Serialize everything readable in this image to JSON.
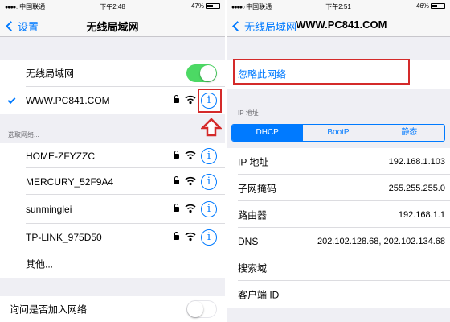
{
  "left": {
    "status": {
      "carrier": "中国联通",
      "time": "下午2:48",
      "battery": "47%",
      "battery_level": 0.47
    },
    "nav": {
      "back": "设置",
      "title": "无线局域网"
    },
    "wlan": {
      "label": "无线局域网",
      "on": true
    },
    "connected": {
      "name": "WWW.PC841.COM"
    },
    "choose_label": "选取网络...",
    "networks": [
      {
        "name": "HOME-ZFYZZC"
      },
      {
        "name": "MERCURY_52F9A4"
      },
      {
        "name": "sunminglei"
      },
      {
        "name": "TP-LINK_975D50"
      }
    ],
    "other": "其他...",
    "ask_join": {
      "label": "询问是否加入网络",
      "on": false
    }
  },
  "right": {
    "status": {
      "carrier": "中国联通",
      "time": "下午2:51",
      "battery": "46%",
      "battery_level": 0.46
    },
    "nav": {
      "back": "无线局域网",
      "title": "WWW.PC841.COM"
    },
    "forget": "忽略此网络",
    "ip_section": "IP 地址",
    "tabs": [
      "DHCP",
      "BootP",
      "静态"
    ],
    "fields": [
      {
        "label": "IP 地址",
        "value": "192.168.1.103"
      },
      {
        "label": "子网掩码",
        "value": "255.255.255.0"
      },
      {
        "label": "路由器",
        "value": "192.168.1.1"
      },
      {
        "label": "DNS",
        "value": "202.102.128.68, 202.102.134.68"
      },
      {
        "label": "搜索域",
        "value": ""
      },
      {
        "label": "客户端 ID",
        "value": ""
      }
    ]
  },
  "colors": {
    "accent": "#007aff",
    "toggle_on": "#4cd964",
    "highlight": "#d42a2a"
  },
  "icons": [
    "chevron-left-icon",
    "checkmark-icon",
    "lock-icon",
    "wifi-icon",
    "info-icon",
    "up-arrow-icon"
  ]
}
